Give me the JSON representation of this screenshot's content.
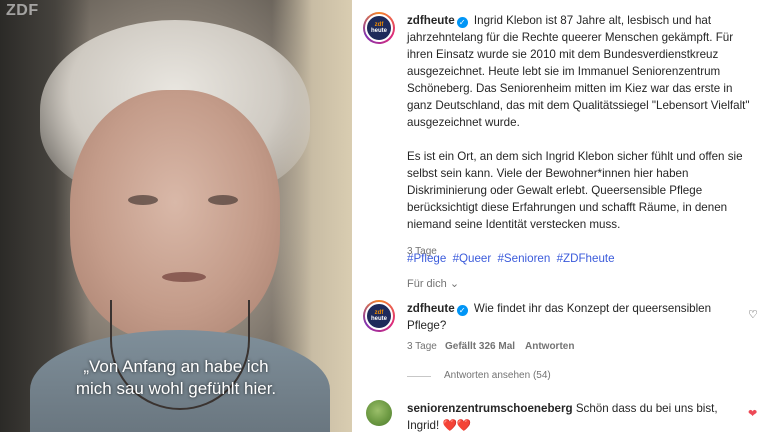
{
  "video": {
    "watermark": "ZDF",
    "subtitle": "„Von Anfang an habe ich\nmich sau wohl gefühlt hier."
  },
  "post": {
    "username": "zdfheute",
    "avatar_text": "zdf heute",
    "caption_p1": "Ingrid Klebon ist 87 Jahre alt, lesbisch und hat jahrzehntelang für die Rechte queerer Menschen gekämpft. Für ihren Einsatz wurde sie 2010 mit dem Bundesverdienstkreuz ausgezeichnet. Heute lebt sie im Immanuel Seniorenzentrum Schöneberg. Das Seniorenheim mitten im Kiez war das erste in ganz Deutschland, das mit dem Qualitätssiegel \"Lebensort Vielfalt\" ausgezeichnet wurde.",
    "caption_p2": "Es ist ein Ort, an dem sich Ingrid Klebon sicher fühlt und offen sie selbst sein kann. Viele der Bewohner*innen hier haben Diskriminierung oder Gewalt erlebt. Queersensible Pflege berücksichtigt diese Erfahrungen und schafft Räume, in denen niemand seine Identität verstecken muss.",
    "hashtags": [
      "#Pflege",
      "#Queer",
      "#Senioren",
      "#ZDFheute"
    ],
    "time": "3 Tage",
    "for_you": "Für dich"
  },
  "comments": [
    {
      "username": "zdfheute",
      "text": "Wie findet ihr das Konzept der queersensiblen Pflege?",
      "time": "3 Tage",
      "likes": "Gefällt 326 Mal",
      "reply": "Antworten",
      "view_replies": "Antworten ansehen (54)",
      "heart": "♡"
    },
    {
      "username": "seniorenzentrumschoeneberg",
      "text": "Schön dass du bei uns bist, Ingrid! ❤️❤️",
      "heart": "❤",
      "heart_color": "#ed4956"
    }
  ],
  "icons": {
    "verified": "✓",
    "chevron": "⌄"
  }
}
